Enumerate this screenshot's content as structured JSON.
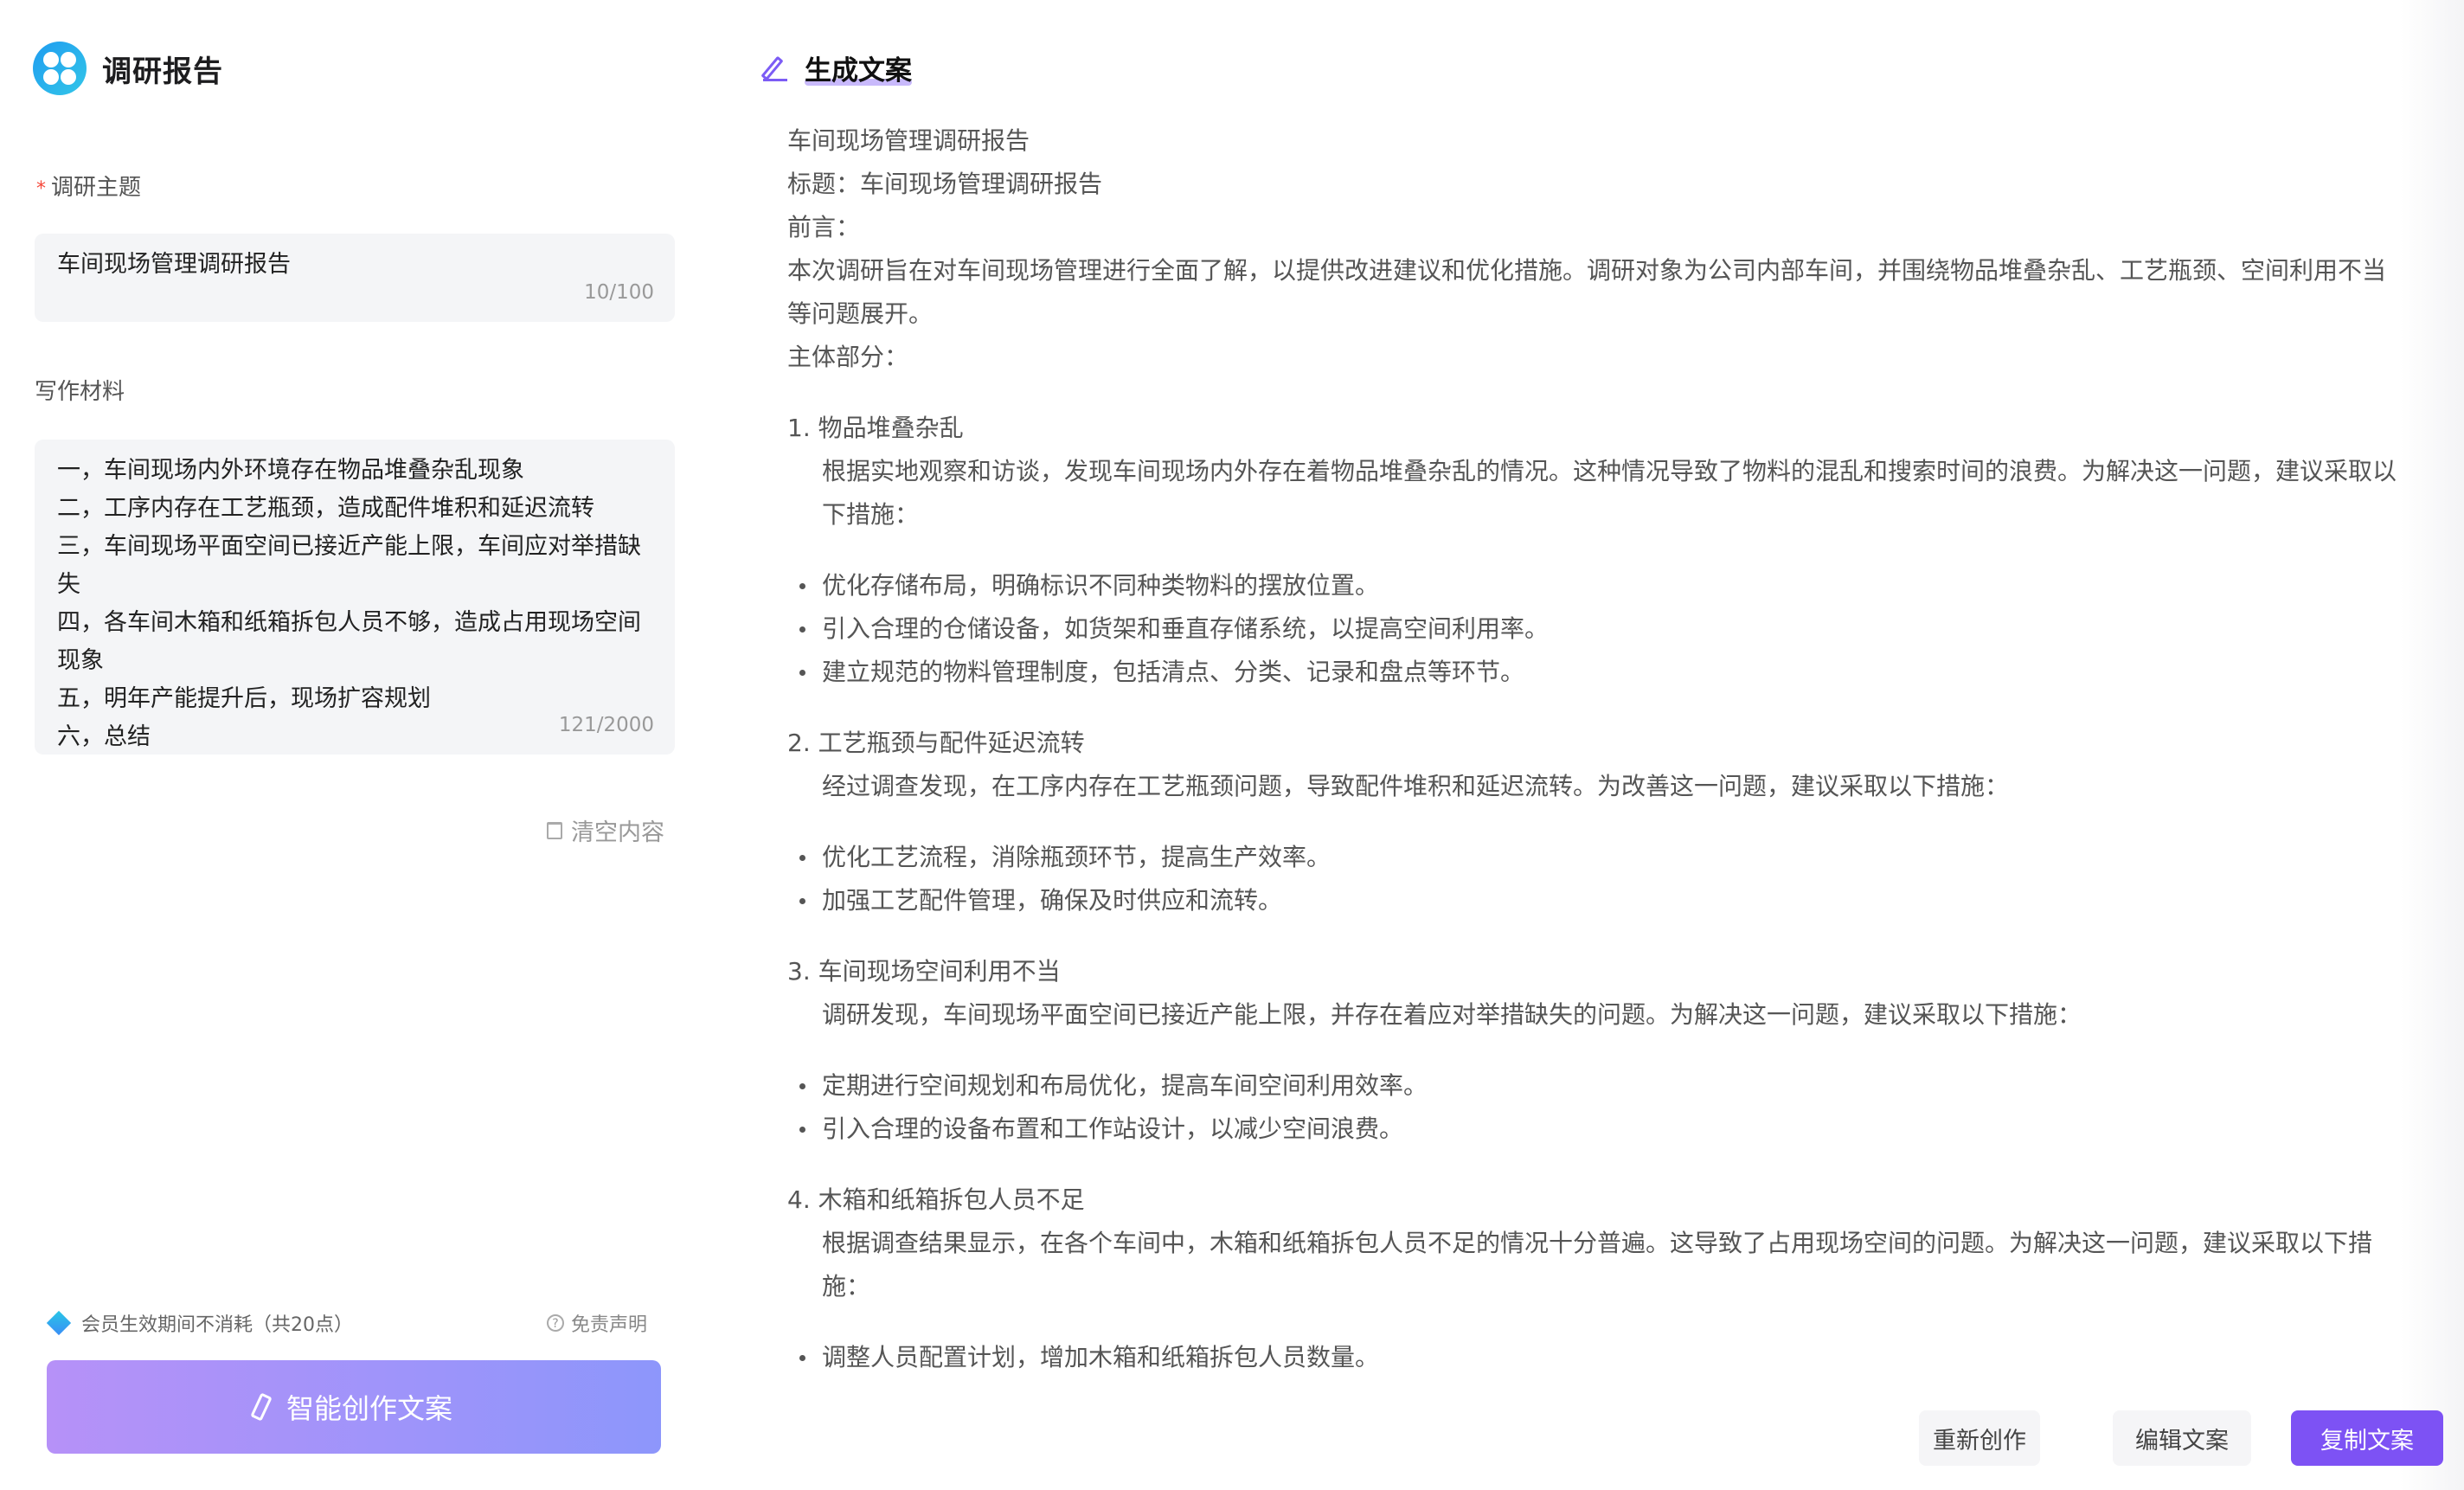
{
  "app": {
    "title": "调研报告"
  },
  "form": {
    "topic_label": "调研主题",
    "required_mark": "*",
    "topic_value": "车间现场管理调研报告",
    "topic_counter": "10/100",
    "material_label": "写作材料",
    "material_lines": [
      "一，车间现场内外环境存在物品堆叠杂乱现象",
      "二，工序内存在工艺瓶颈，造成配件堆积和延迟流转",
      "三，车间现场平面空间已接近产能上限，车间应对举措缺失",
      "四，各车间木箱和纸箱拆包人员不够，造成占用现场空间现象",
      "五，明年产能提升后，现场扩容规划",
      "六，总结"
    ],
    "material_counter": "121/2000",
    "clear_label": "清空内容"
  },
  "footer": {
    "member_note": "会员生效期间不消耗（共20点）",
    "disclaimer": "免责声明",
    "create_label": "智能创作文案"
  },
  "output": {
    "header": "生成文案",
    "line_title": "车间现场管理调研报告",
    "line_heading": "标题：车间现场管理调研报告",
    "line_preface_label": "前言：",
    "preface": "本次调研旨在对车间现场管理进行全面了解，以提供改进建议和优化措施。调研对象为公司内部车间，并围绕物品堆叠杂乱、工艺瓶颈、空间利用不当等问题展开。",
    "body_label": "主体部分：",
    "sections": [
      {
        "title": "1. 物品堆叠杂乱",
        "text": "根据实地观察和访谈，发现车间现场内外存在着物品堆叠杂乱的情况。这种情况导致了物料的混乱和搜索时间的浪费。为解决这一问题，建议采取以下措施：",
        "bullets": [
          "优化存储布局，明确标识不同种类物料的摆放位置。",
          "引入合理的仓储设备，如货架和垂直存储系统，以提高空间利用率。",
          "建立规范的物料管理制度，包括清点、分类、记录和盘点等环节。"
        ]
      },
      {
        "title": "2. 工艺瓶颈与配件延迟流转",
        "text": "经过调查发现，在工序内存在工艺瓶颈问题，导致配件堆积和延迟流转。为改善这一问题，建议采取以下措施：",
        "bullets": [
          "优化工艺流程，消除瓶颈环节，提高生产效率。",
          "加强工艺配件管理，确保及时供应和流转。"
        ]
      },
      {
        "title": "3. 车间现场空间利用不当",
        "text": "调研发现，车间现场平面空间已接近产能上限，并存在着应对举措缺失的问题。为解决这一问题，建议采取以下措施：",
        "bullets": [
          "定期进行空间规划和布局优化，提高车间空间利用效率。",
          "引入合理的设备布置和工作站设计，以减少空间浪费。"
        ]
      },
      {
        "title": "4. 木箱和纸箱拆包人员不足",
        "text": "根据调查结果显示，在各个车间中，木箱和纸箱拆包人员不足的情况十分普遍。这导致了占用现场空间的问题。为解决这一问题，建议采取以下措施：",
        "bullets": [
          "调整人员配置计划，增加木箱和纸箱拆包人员数量。"
        ]
      }
    ]
  },
  "actions": {
    "regenerate": "重新创作",
    "edit": "编辑文案",
    "copy": "复制文案"
  }
}
